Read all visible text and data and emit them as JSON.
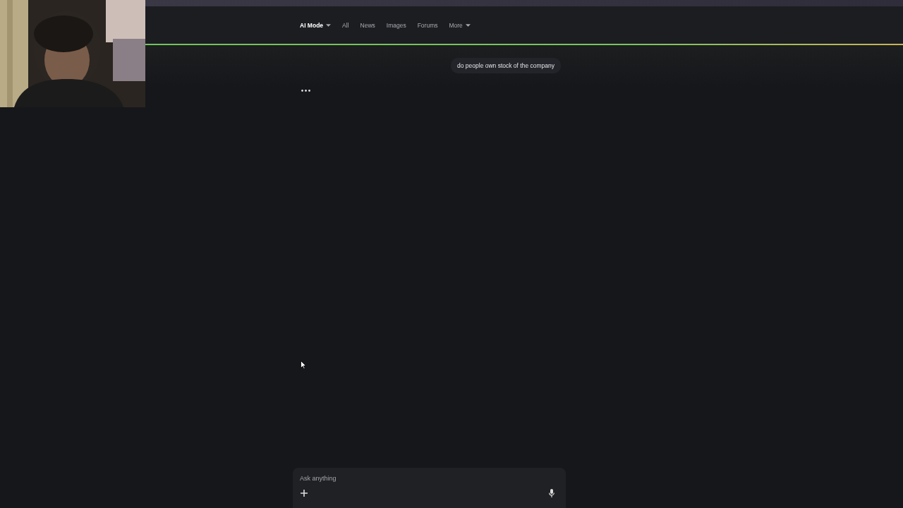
{
  "tabs": [
    {
      "label": "AI Mode",
      "selected": true,
      "menu": true
    },
    {
      "label": "All",
      "selected": false,
      "menu": false
    },
    {
      "label": "News",
      "selected": false,
      "menu": false
    },
    {
      "label": "Images",
      "selected": false,
      "menu": false
    },
    {
      "label": "Forums",
      "selected": false,
      "menu": false
    },
    {
      "label": "More",
      "selected": false,
      "menu": true
    }
  ],
  "conversation": {
    "query": "do people own stock of the company",
    "loading": true
  },
  "composer": {
    "placeholder": "Ask anything"
  }
}
